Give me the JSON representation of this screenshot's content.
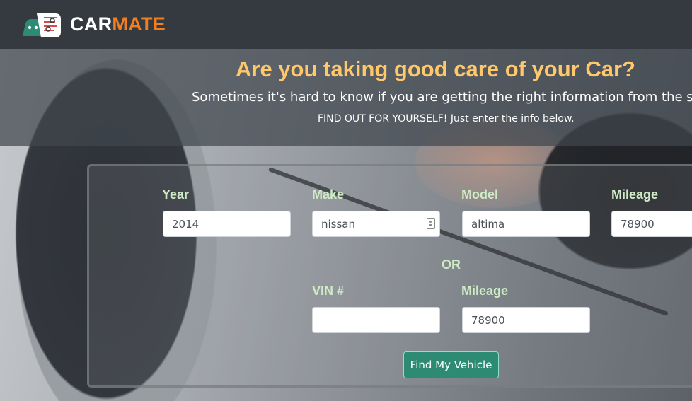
{
  "brand": {
    "part1": "CAR",
    "part2": "MATE",
    "accent_color": "#f07f22",
    "icon": "car-mechanic-logo-icon"
  },
  "hero": {
    "title": "Are you taking good care of your Car?",
    "subtitle": "Sometimes it's hard to know if you are getting the right information from the sh",
    "note": "FIND OUT FOR YOURSELF! Just enter the info below."
  },
  "form": {
    "year": {
      "label": "Year",
      "value": "2014"
    },
    "make": {
      "label": "Make",
      "value": "nissan",
      "icon": "contact-card-icon"
    },
    "model": {
      "label": "Model",
      "value": "altima"
    },
    "mileage": {
      "label": "Mileage",
      "value": "78900"
    },
    "or_label": "OR",
    "vin": {
      "label": "VIN #",
      "value": ""
    },
    "vin_mileage": {
      "label": "Mileage",
      "value": "78900"
    },
    "submit_label": "Find My Vehicle"
  },
  "colors": {
    "header_bg": "#343a40",
    "title": "#ffc86b",
    "label": "#cdebc4",
    "button": "#2e8b73"
  }
}
